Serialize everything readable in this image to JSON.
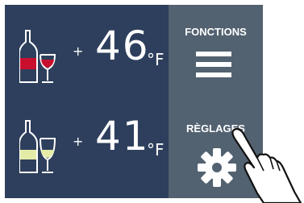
{
  "zones": [
    {
      "wine": "red-wine-icon",
      "plus": "+",
      "temperature": "46",
      "unit": "°F",
      "accent": "#c8102e"
    },
    {
      "wine": "white-wine-icon",
      "plus": "+",
      "temperature": "41",
      "unit": "°F",
      "accent": "#e4eba6"
    }
  ],
  "menu": {
    "functions_label": "FONCTIONS",
    "settings_label": "RÈGLAGES"
  },
  "colors": {
    "temp_panel": "#2e3f5d",
    "menu_panel": "#536271"
  }
}
